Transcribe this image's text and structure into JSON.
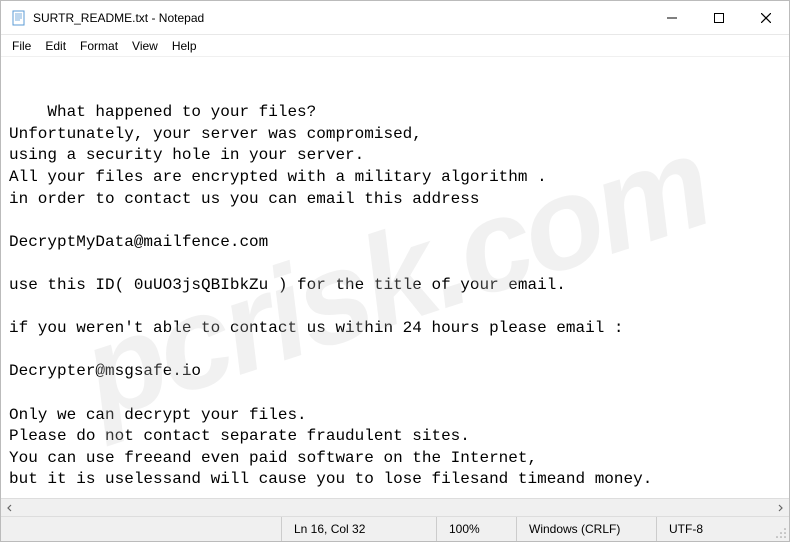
{
  "titlebar": {
    "title": "SURTR_README.txt - Notepad"
  },
  "menubar": {
    "file": "File",
    "edit": "Edit",
    "format": "Format",
    "view": "View",
    "help": "Help"
  },
  "content": {
    "text": "What happened to your files?\nUnfortunately, your server was compromised,\nusing a security hole in your server.\nAll your files are encrypted with a military algorithm .\nin order to contact us you can email this address\n\nDecryptMyData@mailfence.com\n\nuse this ID( 0uUO3jsQBIbkZu ) for the title of your email.\n\nif you weren't able to contact us within 24 hours please email :\n\nDecrypter@msgsafe.io\n\nOnly we can decrypt your files.\nPlease do not contact separate fraudulent sites.\nYou can use freeand even paid software on the Internet,\nbut it is uselessand will cause you to lose filesand timeand money."
  },
  "watermark": "pcrisk.com",
  "statusbar": {
    "position": "Ln 16, Col 32",
    "zoom": "100%",
    "line_ending": "Windows (CRLF)",
    "encoding": "UTF-8"
  }
}
